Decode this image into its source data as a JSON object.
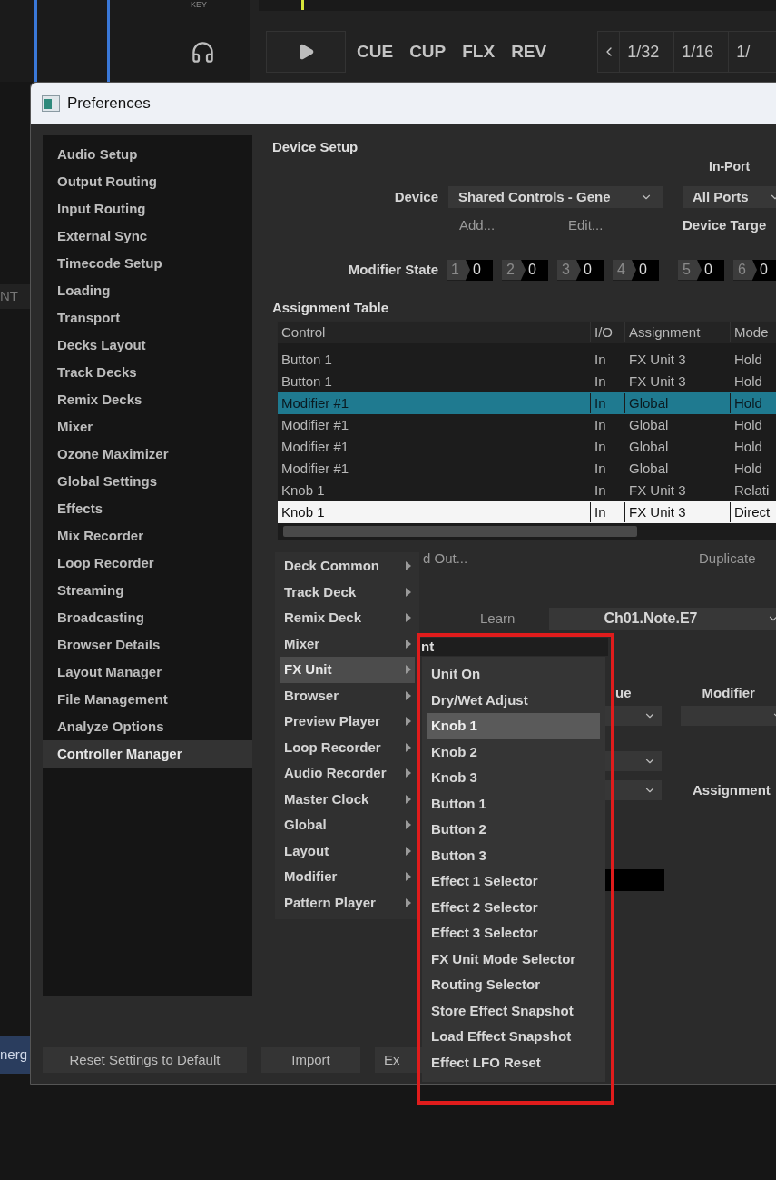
{
  "background_app": {
    "key_label": "KEY",
    "transport_buttons": [
      "CUE",
      "CUP",
      "FLX",
      "REV"
    ],
    "loop_sizes": [
      "1/32",
      "1/16",
      "1/"
    ],
    "side_texts": [
      {
        "text": "NT",
        "kind": "plain"
      },
      {
        "text": "nerg",
        "kind": "tag"
      }
    ]
  },
  "dialog": {
    "title": "Preferences"
  },
  "sidebar": {
    "items": [
      {
        "label": "Audio Setup",
        "selected": false
      },
      {
        "label": "Output Routing",
        "selected": false
      },
      {
        "label": "Input Routing",
        "selected": false
      },
      {
        "label": "External Sync",
        "selected": false
      },
      {
        "label": "Timecode Setup",
        "selected": false
      },
      {
        "label": "Loading",
        "selected": false
      },
      {
        "label": "Transport",
        "selected": false
      },
      {
        "label": "Decks Layout",
        "selected": false
      },
      {
        "label": "Track Decks",
        "selected": false
      },
      {
        "label": "Remix Decks",
        "selected": false
      },
      {
        "label": "Mixer",
        "selected": false
      },
      {
        "label": "Ozone Maximizer",
        "selected": false
      },
      {
        "label": "Global Settings",
        "selected": false
      },
      {
        "label": "Effects",
        "selected": false
      },
      {
        "label": "Mix Recorder",
        "selected": false
      },
      {
        "label": "Loop Recorder",
        "selected": false
      },
      {
        "label": "Streaming",
        "selected": false
      },
      {
        "label": "Broadcasting",
        "selected": false
      },
      {
        "label": "Browser Details",
        "selected": false
      },
      {
        "label": "Layout Manager",
        "selected": false
      },
      {
        "label": "File Management",
        "selected": false
      },
      {
        "label": "Analyze Options",
        "selected": false
      },
      {
        "label": "Controller Manager",
        "selected": true
      }
    ]
  },
  "device_setup": {
    "title": "Device Setup",
    "in_port_label": "In-Port",
    "device_label": "Device",
    "device_value": "Shared Controls - Gene",
    "in_port_value": "All Ports",
    "add_label": "Add...",
    "edit_label": "Edit...",
    "device_target_label": "Device Targe",
    "modifier_state_label": "Modifier State",
    "modifiers": [
      {
        "number": "1",
        "value": "0"
      },
      {
        "number": "2",
        "value": "0"
      },
      {
        "number": "3",
        "value": "0"
      },
      {
        "number": "4",
        "value": "0"
      },
      {
        "number": "5",
        "value": "0"
      },
      {
        "number": "6",
        "value": "0"
      }
    ]
  },
  "assignment_table": {
    "title": "Assignment Table",
    "columns": [
      "Control",
      "I/O",
      "Assignment",
      "Mode"
    ],
    "rows": [
      {
        "cells": [
          "Button 1",
          "In",
          "FX Unit 3",
          "Hold"
        ],
        "selected": false,
        "current": false
      },
      {
        "cells": [
          "Button 1",
          "In",
          "FX Unit 3",
          "Hold"
        ],
        "selected": false,
        "current": false
      },
      {
        "cells": [
          "Modifier #1",
          "In",
          "Global",
          "Hold"
        ],
        "selected": true,
        "current": false
      },
      {
        "cells": [
          "Modifier #1",
          "In",
          "Global",
          "Hold"
        ],
        "selected": false,
        "current": false
      },
      {
        "cells": [
          "Modifier #1",
          "In",
          "Global",
          "Hold"
        ],
        "selected": false,
        "current": false
      },
      {
        "cells": [
          "Modifier #1",
          "In",
          "Global",
          "Hold"
        ],
        "selected": false,
        "current": false
      },
      {
        "cells": [
          "Knob 1",
          "In",
          "FX Unit 3",
          "Relati"
        ],
        "selected": false,
        "current": false
      },
      {
        "cells": [
          "Knob 1",
          "In",
          "FX Unit 3",
          "Direct"
        ],
        "selected": false,
        "current": true
      }
    ]
  },
  "mapping_details": {
    "add_out_fragment": "d Out...",
    "duplicate_label": "Duplicate",
    "learn_label": "Learn",
    "learn_value": "Ch01.Note.E7",
    "field_fragment": "nt",
    "value_fragment": "ue",
    "modifier_label": "Modifier",
    "assignment_label": "Assignment"
  },
  "footer_buttons": [
    "Reset Settings to Default",
    "Import",
    "Ex"
  ],
  "context_menu": {
    "items": [
      {
        "label": "Deck Common",
        "selected": false
      },
      {
        "label": "Track Deck",
        "selected": false
      },
      {
        "label": "Remix Deck",
        "selected": false
      },
      {
        "label": "Mixer",
        "selected": false
      },
      {
        "label": "FX Unit",
        "selected": true
      },
      {
        "label": "Browser",
        "selected": false
      },
      {
        "label": "Preview Player",
        "selected": false
      },
      {
        "label": "Loop Recorder",
        "selected": false
      },
      {
        "label": "Audio Recorder",
        "selected": false
      },
      {
        "label": "Master Clock",
        "selected": false
      },
      {
        "label": "Global",
        "selected": false
      },
      {
        "label": "Layout",
        "selected": false
      },
      {
        "label": "Modifier",
        "selected": false
      },
      {
        "label": "Pattern Player",
        "selected": false
      }
    ]
  },
  "submenu": {
    "items": [
      {
        "label": "Unit On",
        "selected": false
      },
      {
        "label": "Dry/Wet Adjust",
        "selected": false
      },
      {
        "label": "Knob 1",
        "selected": true
      },
      {
        "label": "Knob 2",
        "selected": false
      },
      {
        "label": "Knob 3",
        "selected": false
      },
      {
        "label": "Button 1",
        "selected": false
      },
      {
        "label": "Button 2",
        "selected": false
      },
      {
        "label": "Button 3",
        "selected": false
      },
      {
        "label": "Effect 1 Selector",
        "selected": false
      },
      {
        "label": "Effect 2 Selector",
        "selected": false
      },
      {
        "label": "Effect 3 Selector",
        "selected": false
      },
      {
        "label": "FX Unit Mode Selector",
        "selected": false
      },
      {
        "label": "Routing Selector",
        "selected": false
      },
      {
        "label": "Store Effect Snapshot",
        "selected": false
      },
      {
        "label": "Load Effect Snapshot",
        "selected": false
      },
      {
        "label": "Effect LFO Reset",
        "selected": false
      }
    ]
  }
}
